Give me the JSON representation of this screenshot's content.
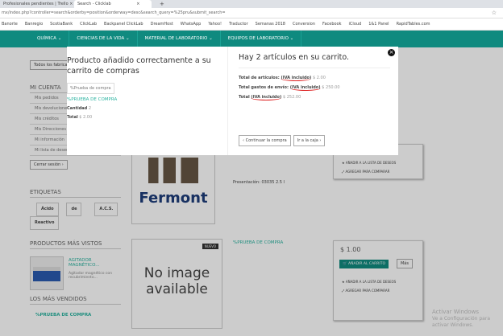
{
  "browser": {
    "tabs": [
      {
        "label": "Profesionales pendientes | Trello"
      },
      {
        "label": "Search - Clicklab"
      }
    ],
    "new_tab": "+",
    "url": "mx/index.php?controller=search&orderby=position&orderway=desc&search_query=%25pru&submit_search=",
    "bookmarks": [
      "Banorte",
      "Banregio",
      "ScotiaBank",
      "ClickLab",
      "Backpanel ClickLab",
      "DreamHost",
      "WhatsApp",
      "Yahoo!",
      "Traductor",
      "Semanas 2018",
      "Conversion",
      "Facebook",
      "iCloud",
      "1&1 Panel",
      "RapidTables.com"
    ]
  },
  "nav": {
    "items": [
      "QUÍMICA ⌄",
      "CIENCIAS DE LA VIDA ⌄",
      "MATERIAL DE LABORATORIO ⌄",
      "EQUIPOS DE LABORATORIO ⌄"
    ]
  },
  "sidebar": {
    "manufacturers_select": "Todos los fabricantes",
    "account_title": "MI CUENTA",
    "account_links": [
      "Mis pedidos",
      "Mis devoluciones",
      "Mis créditos",
      "Mis Direcciones",
      "Mi información",
      "Mi lista de deseos"
    ],
    "logout": "Cerrar sesión",
    "tags_title": "ETIQUETAS",
    "tags": [
      "Ácido",
      "de",
      "A.C.S.",
      "Reactivo"
    ],
    "viewed_title": "PRODUCTOS MÁS VISTOS",
    "viewed_item": {
      "name": "AGITADOR MAGNÉTICO...",
      "desc": "Agitador magnético con recubrimiento..."
    },
    "best_title": "LOS MÁS VENDIDOS",
    "best_item": "%PRUEBA DE COMPRA"
  },
  "products": [
    {
      "brand": "Fermont",
      "presentation": "Presentación: 03035 2.5 l",
      "wishlist": "AÑADIR A LA LISTA DE DESEOS",
      "compare": "AGREGAR PARA COMPARAR"
    },
    {
      "badge": "NUEVO",
      "noimage": "No image available",
      "name": "%PRUEBA DE COMPRA",
      "price": "$ 1.00",
      "add": "AÑADIR AL CARRITO",
      "more": "Más",
      "wishlist": "AÑADIR A LA LISTA DE DESEOS",
      "compare": "AGREGAR PARA COMPARAR"
    }
  ],
  "modal": {
    "left_title": "Producto añadido correctamente a su carrito de compras",
    "img_alt": "%Prueba de compra",
    "product_name": "%PRUEBA DE COMPRA",
    "qty_label": "Cantidad",
    "qty": "2",
    "total_label": "Total",
    "total": "$ 2.00",
    "right_title": "Hay 2 artículos en su carrito.",
    "rows": [
      {
        "label": "Total de artículos:",
        "tax": "(IVA incluido)",
        "value": "$ 2.00"
      },
      {
        "label": "Total gastos de envío:",
        "tax": "(IVA incluido)",
        "value": "$ 250.00"
      },
      {
        "label": "Total",
        "tax": "(IVA incluido)",
        "value": "$ 252.00"
      }
    ],
    "continue": "Continuar la compra",
    "checkout": "Ir a la caja"
  },
  "windows": {
    "title": "Activar Windows",
    "sub": "Ve a Configuración para activar Windows."
  }
}
